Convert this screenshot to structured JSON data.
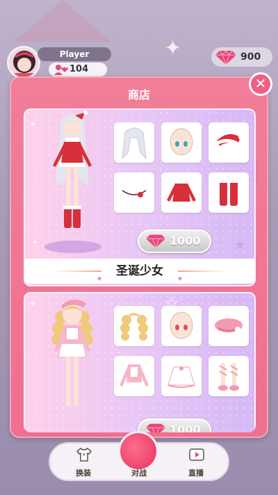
{
  "player": {
    "name": "Player",
    "score": "104"
  },
  "currency": {
    "gems": "900"
  },
  "shop": {
    "title": "商店",
    "close_label": "✕",
    "outfits": [
      {
        "name": "圣诞少女",
        "price": "1000"
      },
      {
        "name": "",
        "price": "1000"
      }
    ]
  },
  "nav": {
    "items": [
      "换装",
      "对战",
      "直播"
    ]
  },
  "colors": {
    "accent": "#ef6f8f",
    "gem": "#e8457a",
    "card_bg": "#e8c7f6"
  }
}
